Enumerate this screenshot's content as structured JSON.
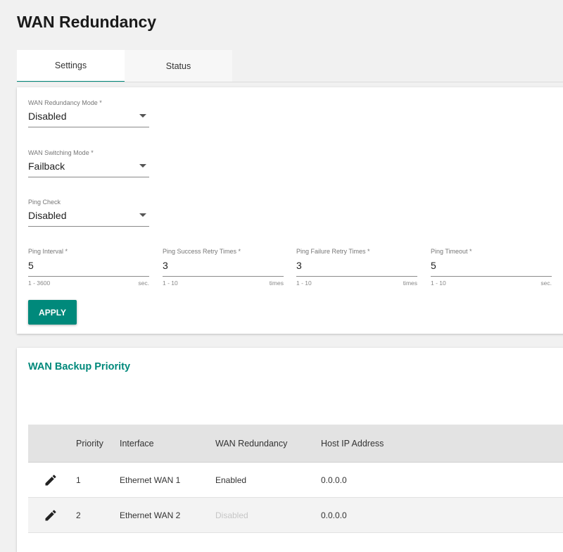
{
  "page": {
    "title": "WAN Redundancy"
  },
  "tabs": [
    {
      "label": "Settings",
      "active": true
    },
    {
      "label": "Status",
      "active": false
    }
  ],
  "settings": {
    "wan_redundancy_mode": {
      "label": "WAN Redundancy Mode *",
      "value": "Disabled"
    },
    "wan_switching_mode": {
      "label": "WAN Switching Mode *",
      "value": "Failback"
    },
    "ping_check": {
      "label": "Ping Check",
      "value": "Disabled"
    },
    "ping_interval": {
      "label": "Ping Interval *",
      "value": "5",
      "range": "1 - 3600",
      "unit": "sec."
    },
    "ping_success_retry": {
      "label": "Ping Success Retry Times *",
      "value": "3",
      "range": "1 - 10",
      "unit": "times"
    },
    "ping_failure_retry": {
      "label": "Ping Failure Retry Times *",
      "value": "3",
      "range": "1 - 10",
      "unit": "times"
    },
    "ping_timeout": {
      "label": "Ping Timeout *",
      "value": "5",
      "range": "1 - 10",
      "unit": "sec."
    },
    "apply_label": "APPLY"
  },
  "backup_priority": {
    "title": "WAN Backup Priority",
    "columns": {
      "priority": "Priority",
      "interface": "Interface",
      "wan_redundancy": "WAN Redundancy",
      "host_ip": "Host IP Address"
    },
    "rows": [
      {
        "priority": "1",
        "interface": "Ethernet WAN 1",
        "wan_redundancy": "Enabled",
        "host_ip": "0.0.0.0"
      },
      {
        "priority": "2",
        "interface": "Ethernet WAN 2",
        "wan_redundancy": "Disabled",
        "host_ip": "0.0.0.0"
      }
    ]
  },
  "colors": {
    "accent": "#00897b",
    "disabled_text": "#c6c6c6"
  },
  "icons": {
    "edit": "pencil-icon",
    "dropdown": "chevron-down-icon"
  }
}
